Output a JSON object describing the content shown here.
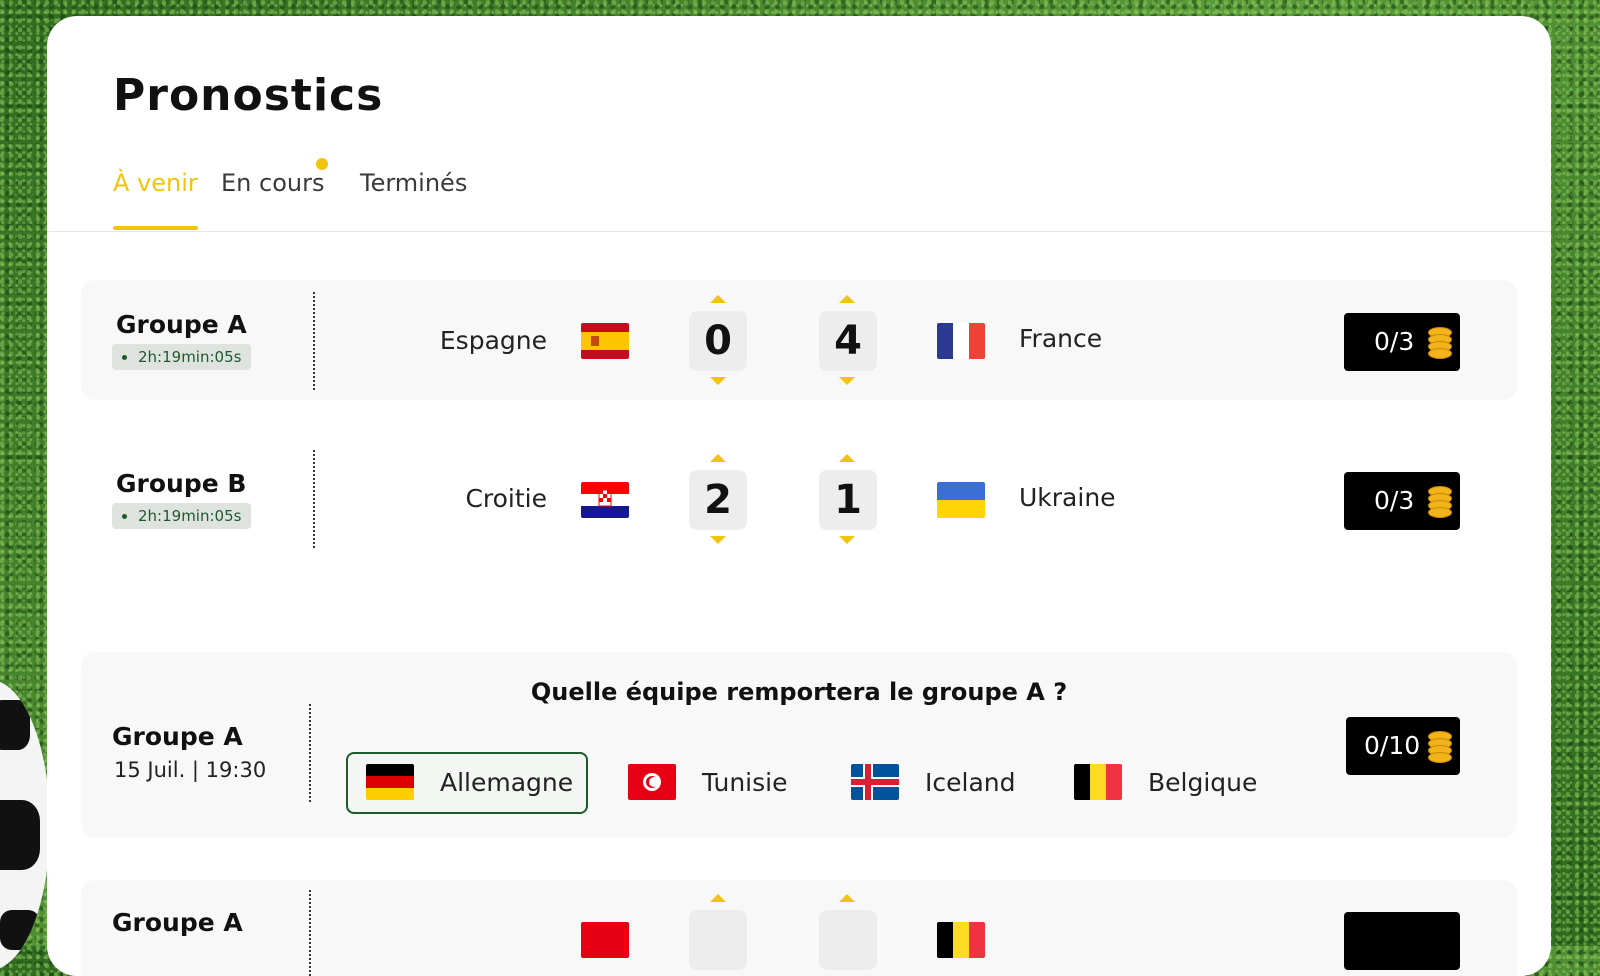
{
  "page": {
    "title": "Pronostics"
  },
  "tabs": [
    {
      "label": "À venir",
      "active": true
    },
    {
      "label": "En cours",
      "has_notification": true
    },
    {
      "label": "Terminés"
    }
  ],
  "matches": [
    {
      "group": "Groupe A",
      "countdown": "2h:19min:05s",
      "home": {
        "name": "Espagne",
        "flag": "spain-flag",
        "score": "0"
      },
      "away": {
        "name": "France",
        "flag": "france-flag",
        "score": "4"
      },
      "points": "0/3",
      "points_icon": "coins-icon"
    },
    {
      "group": "Groupe B",
      "countdown": "2h:19min:05s",
      "home": {
        "name": "Croitie",
        "flag": "croatia-flag",
        "score": "2"
      },
      "away": {
        "name": "Ukraine",
        "flag": "ukraine-flag",
        "score": "1"
      },
      "points": "0/3",
      "points_icon": "coins-icon"
    }
  ],
  "group_question": {
    "group": "Groupe A",
    "date": "15 Juil. | 19:30",
    "question": "Quelle équipe remportera le groupe A ?",
    "options": [
      {
        "name": "Allemagne",
        "flag": "germany-flag",
        "selected": true
      },
      {
        "name": "Tunisie",
        "flag": "tunisia-flag"
      },
      {
        "name": "Iceland",
        "flag": "iceland-flag"
      },
      {
        "name": "Belgique",
        "flag": "belgium-flag"
      }
    ],
    "points": "0/10",
    "points_icon": "coins-icon"
  },
  "partial_row": {
    "group": "Groupe A"
  },
  "colors": {
    "accent_yellow": "#f2c40d",
    "timer_green": "#1e5a2c",
    "points_bg": "#000000"
  }
}
